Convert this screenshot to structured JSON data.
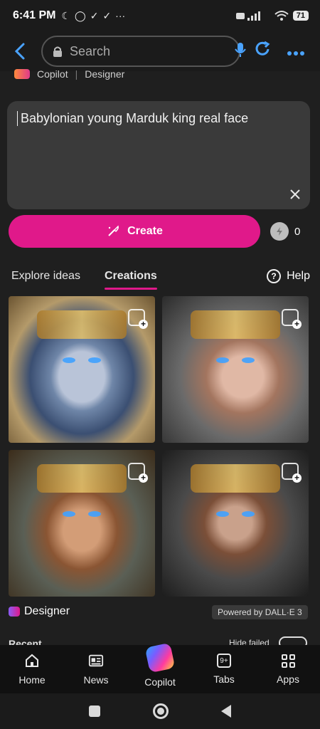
{
  "status_bar": {
    "time": "6:41 PM",
    "battery": "71"
  },
  "browser": {
    "search_placeholder": "Search"
  },
  "page_header": {
    "app_name": "Copilot",
    "section": "Designer"
  },
  "prompt": {
    "text": "Babylonian young Marduk king real face"
  },
  "create": {
    "label": "Create",
    "boost_count": "0"
  },
  "tabs": {
    "explore": "Explore ideas",
    "creations": "Creations",
    "help": "Help"
  },
  "footer": {
    "designer_label": "Designer",
    "powered_by": "Powered by DALL·E 3",
    "recent_partial": "Recent",
    "hide_failed_partial": "Hide failed"
  },
  "bottom_nav": [
    {
      "label": "Home"
    },
    {
      "label": "News"
    },
    {
      "label": "Copilot"
    },
    {
      "label": "Tabs",
      "badge": "9+"
    },
    {
      "label": "Apps"
    }
  ],
  "colors": {
    "accent_pink": "#e0198a",
    "browser_blue": "#4aa3ff"
  }
}
